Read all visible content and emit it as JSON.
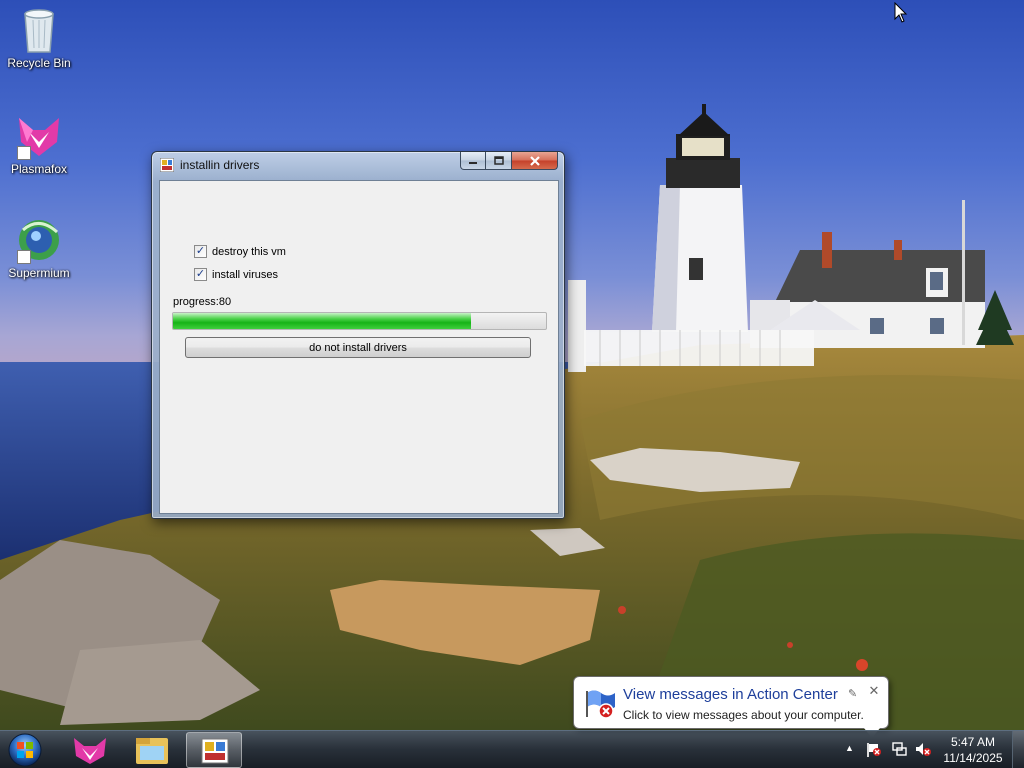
{
  "desktop": {
    "icons": [
      {
        "label": "Recycle Bin"
      },
      {
        "label": "Plasmafox"
      },
      {
        "label": "Supermium"
      }
    ]
  },
  "window": {
    "title": "installin drivers",
    "checkboxes": [
      {
        "label": "destroy this vm",
        "checked": true
      },
      {
        "label": "install viruses",
        "checked": true
      }
    ],
    "progress_label": "progress:80",
    "progress_value": 80,
    "button_label": "do not install drivers"
  },
  "notification": {
    "title": "View messages in Action Center",
    "body": "Click to view messages about your computer."
  },
  "taskbar": {
    "clock_time": "5:47 AM",
    "clock_date": "11/14/2025"
  },
  "colors": {
    "progress_green": "#17b317",
    "balloon_title": "#1e3f9b"
  }
}
